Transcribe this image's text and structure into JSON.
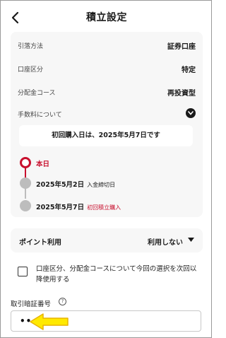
{
  "header": {
    "title": "積立設定"
  },
  "details": [
    {
      "label": "引落方法",
      "value": "証券口座"
    },
    {
      "label": "口座区分",
      "value": "特定"
    },
    {
      "label": "分配金コース",
      "value": "再投資型"
    }
  ],
  "fee": {
    "label": "手数料について"
  },
  "notice": "初回購入日は、2025年5月7日です",
  "timeline": {
    "today": "本日",
    "step2_date": "2025年5月2日",
    "step2_note": "入金締切日",
    "step3_date": "2025年5月7日",
    "step3_note": "初回積立購入"
  },
  "points": {
    "label": "ポイント利用",
    "value": "利用しない"
  },
  "remember": {
    "text": "口座区分、分配金コースについて今回の選択を次回以降使用する",
    "checked": false
  },
  "pin": {
    "label": "取引暗証番号",
    "help": "?",
    "value": "••••"
  },
  "colors": {
    "accent": "#c8102e",
    "card_bg": "#f7f7f7",
    "arrow_fill": "#ffe900",
    "arrow_stroke": "#e8b400"
  },
  "icons": {
    "back": "chevron-left-icon",
    "expand": "chevron-down-icon",
    "points_caret": "caret-down-icon",
    "help": "help-circle-icon",
    "pointer": "yellow-arrow-icon"
  }
}
